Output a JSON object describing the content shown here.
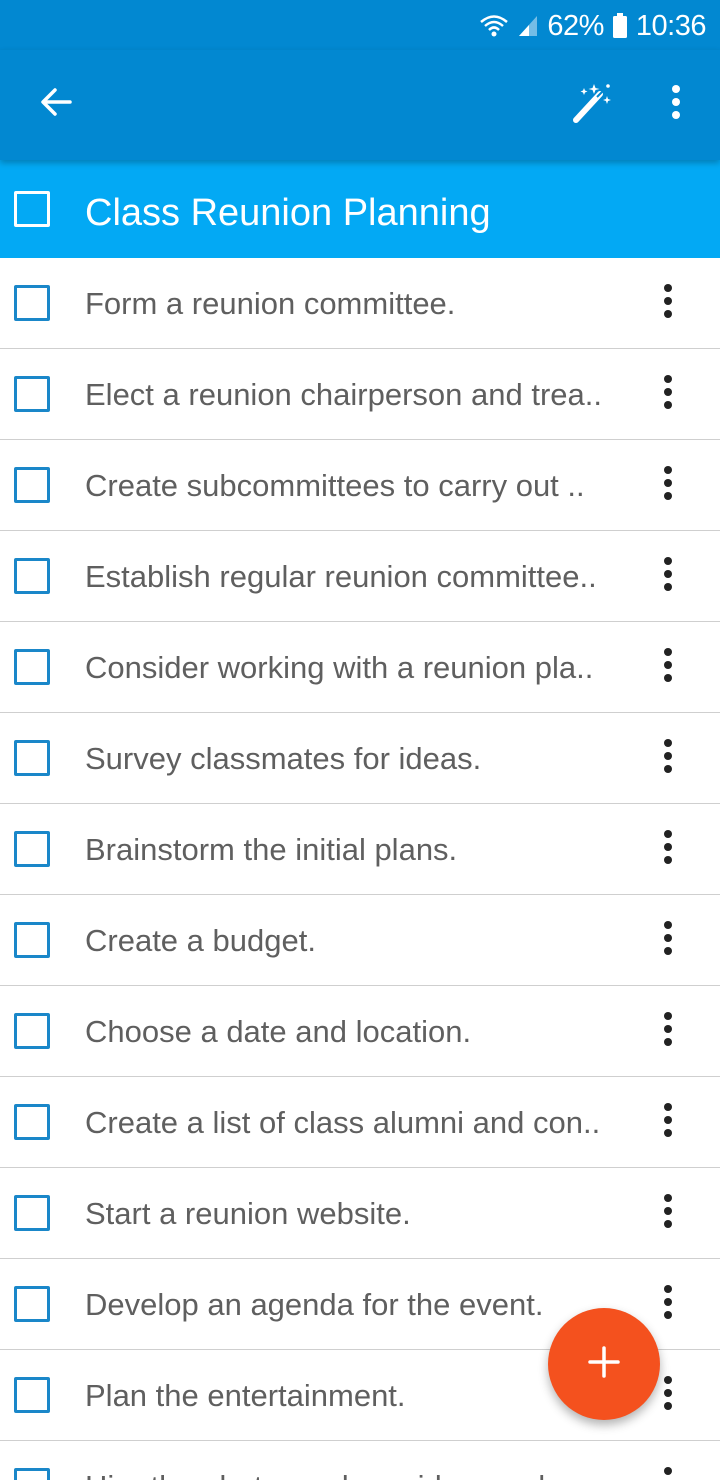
{
  "status_bar": {
    "battery_percent": "62%",
    "time": "10:36",
    "icons": [
      "wifi-icon",
      "signal-icon",
      "battery-icon"
    ]
  },
  "app_bar": {
    "icons": [
      "back-arrow-icon",
      "magic-wand-icon",
      "more-vert-icon"
    ],
    "background": "#0288d1"
  },
  "list": {
    "title": "Class Reunion Planning",
    "header_background": "#03a9f4",
    "tasks": [
      {
        "label": "Form a reunion committee."
      },
      {
        "label": "Elect a reunion chairperson and trea.."
      },
      {
        "label": "Create subcommittees to carry out .."
      },
      {
        "label": "Establish regular reunion committee.."
      },
      {
        "label": "Consider working with a reunion pla.."
      },
      {
        "label": "Survey classmates for ideas."
      },
      {
        "label": "Brainstorm the initial plans."
      },
      {
        "label": "Create a budget."
      },
      {
        "label": "Choose a date and location."
      },
      {
        "label": "Create a list of class alumni and con.."
      },
      {
        "label": "Start a reunion website."
      },
      {
        "label": "Develop an agenda for the event."
      },
      {
        "label": "Plan the entertainment."
      },
      {
        "label": "Hire the photographer, videographe.."
      }
    ]
  },
  "fab": {
    "icon": "plus-icon",
    "color": "#f4511e"
  }
}
